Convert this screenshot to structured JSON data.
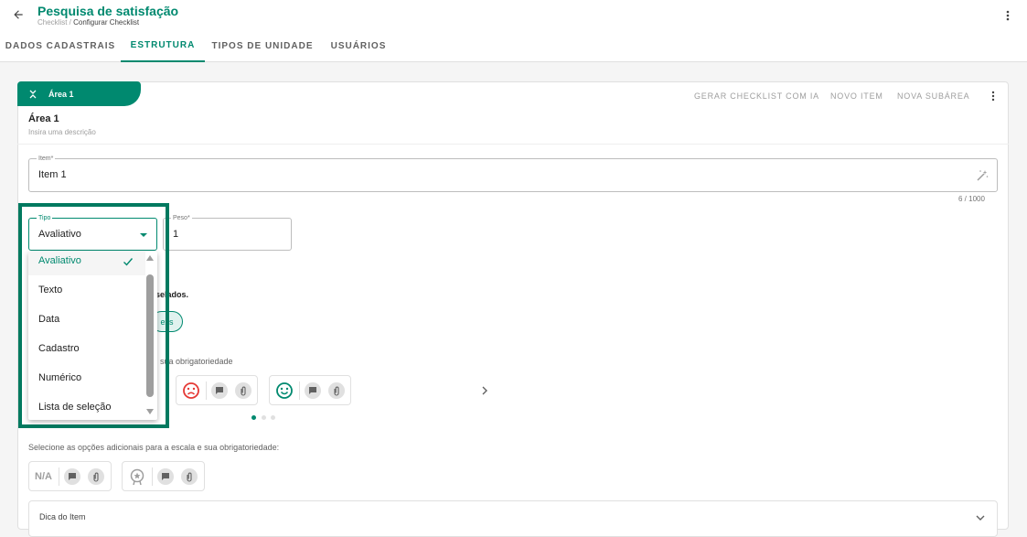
{
  "header": {
    "title": "Pesquisa de satisfação",
    "breadcrumb_root": "Checklist",
    "breadcrumb_sep": " / ",
    "breadcrumb_current": "Configurar Checklist"
  },
  "tabs": [
    {
      "label": "DADOS CADASTRAIS"
    },
    {
      "label": "ESTRUTURA"
    },
    {
      "label": "TIPOS DE UNIDADE"
    },
    {
      "label": "USUÁRIOS"
    }
  ],
  "area": {
    "tab_label": "Área 1",
    "name": "Área 1",
    "description": "Insira uma descrição",
    "actions": {
      "generate": "GERAR CHECKLIST COM IA",
      "new_item": "NOVO ITEM",
      "new_subarea": "NOVA SUBÁREA"
    }
  },
  "item": {
    "label": "Item*",
    "value": "Item 1",
    "counter": "6 / 1000"
  },
  "tipo": {
    "label": "Tipo",
    "value": "Avaliativo",
    "options": [
      "Avaliativo",
      "Texto",
      "Data",
      "Cadastro",
      "Numérico",
      "Lista de seleção"
    ]
  },
  "peso": {
    "label": "Peso*",
    "value": "1"
  },
  "fragments": {
    "selected": "selados.",
    "chip": "exs",
    "obrigatoriedade": "sua obrigatoriedade"
  },
  "additional": {
    "text": "Selecione as opções adicionais para a escala e sua obrigatoriedade:",
    "na": "N/A"
  },
  "dica": {
    "label": "Dica do Item"
  },
  "colors": {
    "accent": "#00896f",
    "highlight": "#00795f",
    "sad": "#e53935",
    "happy": "#00896f"
  }
}
